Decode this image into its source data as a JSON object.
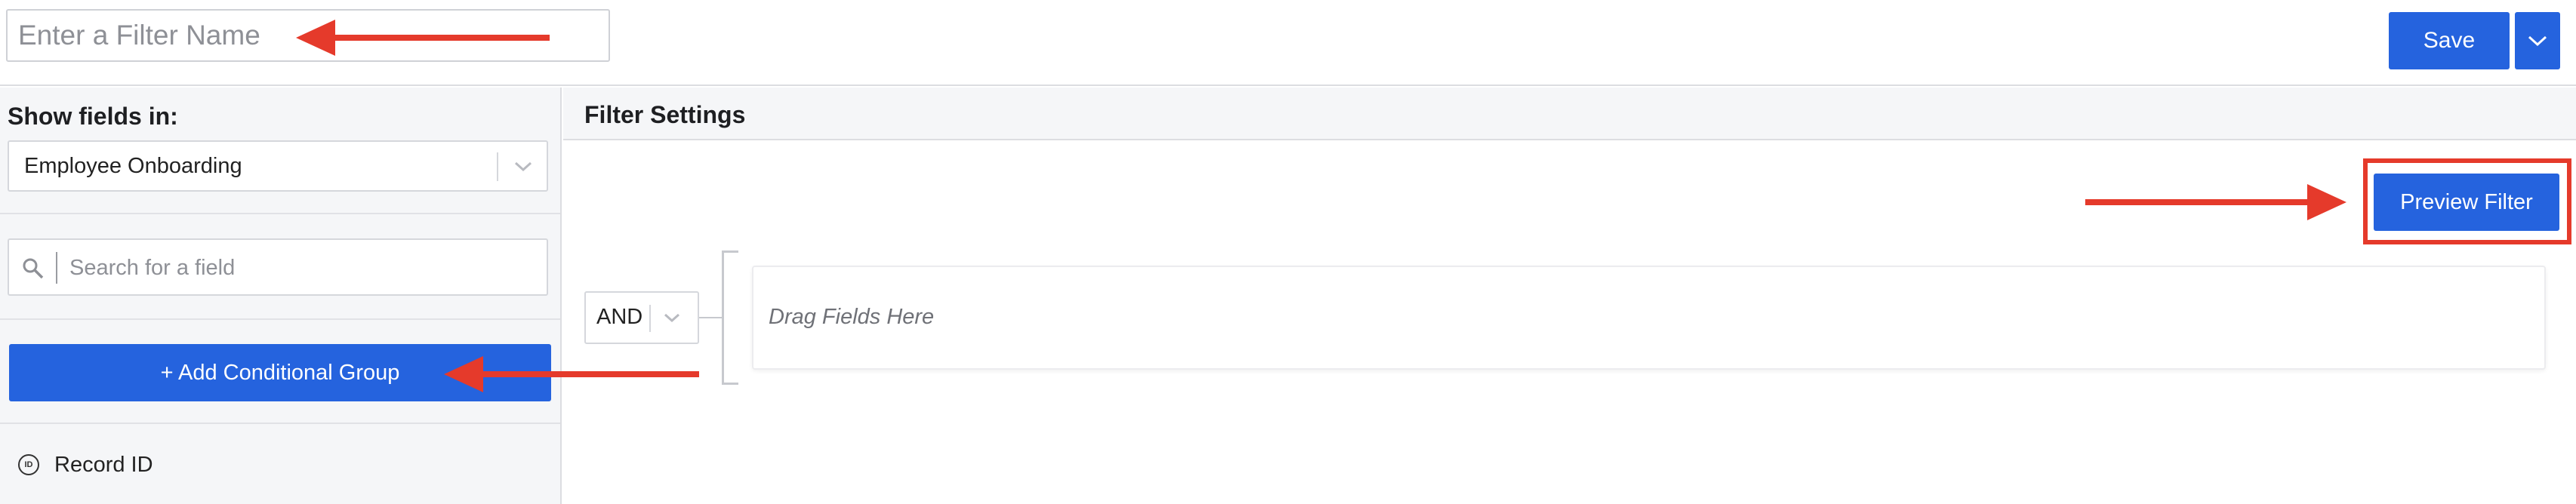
{
  "header": {
    "filter_name_placeholder": "Enter a Filter Name",
    "save_label": "Save"
  },
  "sidebar": {
    "show_fields_label": "Show fields in:",
    "module_value": "Employee Onboarding",
    "search_placeholder": "Search for a field",
    "add_group_label": "+ Add Conditional Group",
    "fields": [
      {
        "icon": "ID",
        "label": "Record ID"
      }
    ]
  },
  "settings": {
    "title": "Filter Settings",
    "preview_label": "Preview Filter",
    "operator_value": "AND",
    "drop_zone_label": "Drag Fields Here"
  },
  "colors": {
    "primary": "#2563de",
    "annotation": "#e53a2b"
  },
  "icons": [
    "chevron-down-icon",
    "search-icon",
    "record-id-icon",
    "annotation-arrow"
  ]
}
